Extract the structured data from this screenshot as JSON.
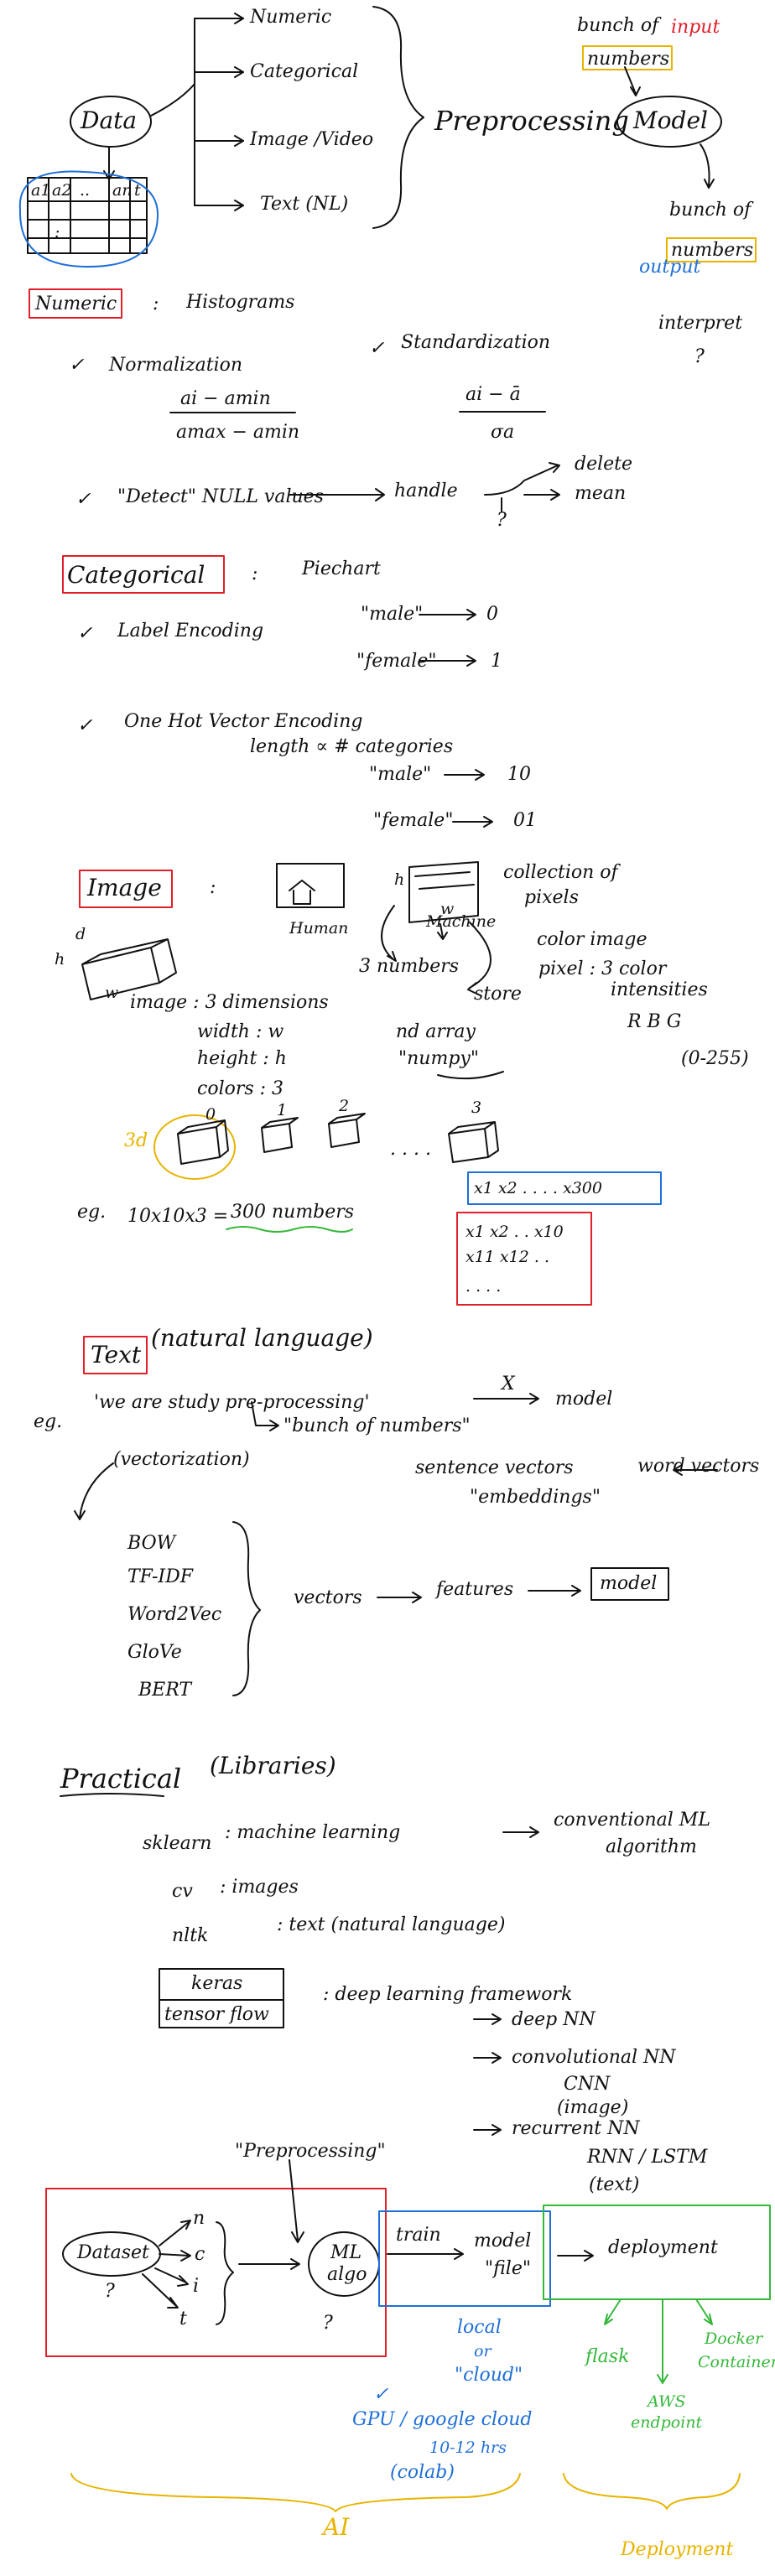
{
  "top": {
    "data": "Data",
    "types": [
      "Numeric",
      "Categorical",
      "Image /Video",
      "Text (NL)"
    ],
    "preprocessing": "Preprocessing",
    "bunch_of": "bunch of",
    "input": "input",
    "numbers": "numbers",
    "model": "Model",
    "bunch_of_out": "bunch of",
    "numbers_out": "numbers",
    "output": "output",
    "interpret": "interpret",
    "q": "?",
    "table_head": [
      "a1",
      "a2",
      "..",
      "an",
      "t"
    ],
    "table_dots": ":"
  },
  "numeric": {
    "heading": "Numeric",
    "colon": ":",
    "histograms": "Histograms",
    "check": "✓",
    "normalization": "Normalization",
    "standardization": "Standardization",
    "norm_num": "ai − amin",
    "norm_den": "amax − amin",
    "std_num": "ai − ā",
    "std_den": "σa",
    "detect": "\"Detect\" NULL values",
    "handle": "handle",
    "q": "?",
    "delete": "delete",
    "mean": "mean"
  },
  "categorical": {
    "heading": "Categorical",
    "colon": ":",
    "piechart": "Piechart",
    "label_enc": "Label Encoding",
    "male": "\"male\"",
    "male_val": "0",
    "female": "\"female\"",
    "female_val": "1",
    "onehot": "One Hot Vector Encoding",
    "length": "length ∝ # categories",
    "male_vec": "10",
    "female_vec": "01"
  },
  "image": {
    "heading": "Image",
    "colon": ":",
    "human": "Human",
    "machine": "Machine",
    "h": "h",
    "w": "w",
    "d": "d",
    "collection": "collection of",
    "pixels": "pixels",
    "color_image": "color image",
    "pixel": "pixel : 3 color",
    "intensities": "intensities",
    "rbg": "R   B   G",
    "range": "(0-255)",
    "three_numbers": "3 numbers",
    "store": "store",
    "nd_array": "nd array",
    "numpy": "\"numpy\"",
    "dims": [
      "image : 3 dimensions",
      "width : w",
      "height : h",
      "colors : 3"
    ],
    "three_d": "3d",
    "idx": [
      "0",
      "1",
      "2",
      "3"
    ],
    "dots": ". . . .",
    "eg": "eg.",
    "formula": "10x10x3 =",
    "result": "300 numbers",
    "row_vec": "x1  x2  . . . .      x300",
    "mat_r1": "x1  x2  . .   x10",
    "mat_r2": "x11 x12  . .",
    "mat_r3": ". . . ."
  },
  "text": {
    "heading": "Text",
    "natural": "(natural language)",
    "eg": "eg.",
    "sentence": "'we are study pre-processing'",
    "x": "X",
    "model": "model",
    "vectorization": "(vectorization)",
    "bunch": "\"bunch of numbers\"",
    "sentence_vec": "sentence vectors",
    "word_vec": "word vectors",
    "embeddings": "\"embeddings\"",
    "methods": [
      "BOW",
      "TF-IDF",
      "Word2Vec",
      "GloVe",
      "BERT"
    ],
    "vectors": "vectors",
    "features": "features",
    "model_box": "model"
  },
  "practical": {
    "heading": "Practical",
    "libraries": "(Libraries)",
    "sklearn": "sklearn",
    "sklearn_desc": ": machine learning",
    "conventional": "conventional ML",
    "algorithm": "algorithm",
    "cv": "cv",
    "cv_desc": ": images",
    "nltk": "nltk",
    "nltk_desc": ": text (natural language)",
    "keras": "keras",
    "tensorflow": "tensor flow",
    "dl": ": deep learning framework",
    "deep_nn": "deep NN",
    "conv_nn": "convolutional NN",
    "cnn": "CNN",
    "cnn_img": "(image)",
    "rec_nn": "recurrent NN",
    "rnn": "RNN / LSTM",
    "rnn_txt": "(text)"
  },
  "pipeline": {
    "preprocessing": "\"Preprocessing\"",
    "dataset": "Dataset",
    "q": "?",
    "branches": [
      "n",
      "c",
      "i",
      "t"
    ],
    "ml": "ML",
    "algo": "algo",
    "q2": "?",
    "train": "train",
    "model": "model",
    "file": "\"file\"",
    "deployment": "deployment",
    "local": "local",
    "or": "or",
    "cloud": "\"cloud\"",
    "check": "✓",
    "gpu": "GPU / google cloud",
    "hrs": "10-12 hrs",
    "colab": "(colab)",
    "flask": "flask",
    "docker": "Docker",
    "container": "Container",
    "aws": "AWS",
    "endpoint": "endpoint",
    "ai": "AI",
    "deploy_label": "Deployment"
  },
  "colors": {
    "ink": "#111111",
    "red": "#e0202a",
    "blue": "#1f6fd6",
    "green": "#35b83a",
    "yellow": "#e8b400"
  }
}
